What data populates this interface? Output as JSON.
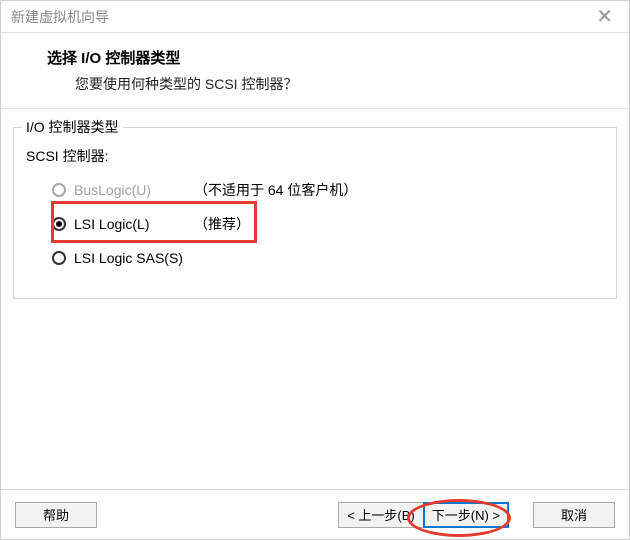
{
  "window": {
    "title": "新建虚拟机向导"
  },
  "header": {
    "title": "选择 I/O 控制器类型",
    "subtitle": "您要使用何种类型的 SCSI 控制器？"
  },
  "group": {
    "legend": "I/O 控制器类型",
    "scsi_label": "SCSI 控制器:",
    "options": {
      "buslogic": {
        "label": "BusLogic(U)",
        "note": "（不适用于 64 位客户机）",
        "selected": false,
        "enabled": false
      },
      "lsilogic": {
        "label": "LSI Logic(L)",
        "note": "（推荐）",
        "selected": true,
        "enabled": true
      },
      "lsilogic_sas": {
        "label": "LSI Logic SAS(S)",
        "note": "",
        "selected": false,
        "enabled": true
      }
    }
  },
  "footer": {
    "help": "帮助",
    "back": "< 上一步(B)",
    "next": "下一步(N) >",
    "cancel": "取消"
  }
}
